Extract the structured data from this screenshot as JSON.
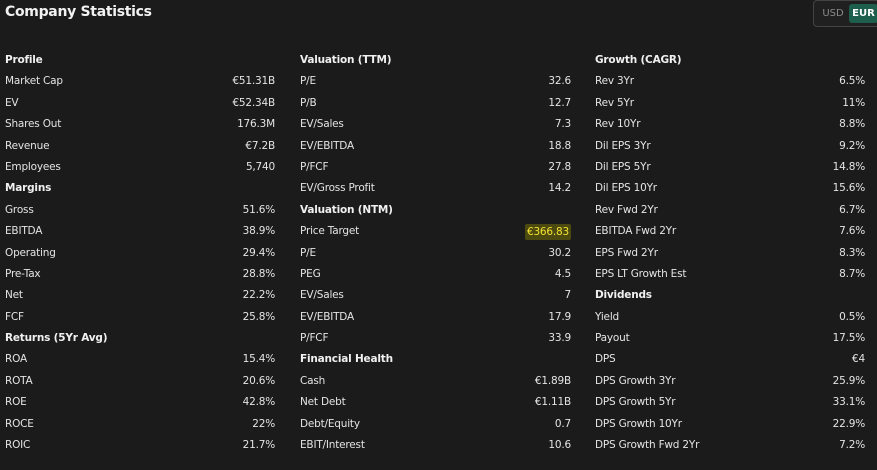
{
  "header": {
    "title": "Company Statistics",
    "currency_usd": "USD",
    "currency_eur": "EUR"
  },
  "columns": [
    {
      "sections": [
        {
          "title": "Profile",
          "rows": [
            {
              "label": "Market Cap",
              "value": "€51.31B"
            },
            {
              "label": "EV",
              "value": "€52.34B"
            },
            {
              "label": "Shares Out",
              "value": "176.3M"
            },
            {
              "label": "Revenue",
              "value": "€7.2B"
            },
            {
              "label": "Employees",
              "value": "5,740"
            }
          ]
        },
        {
          "title": "Margins",
          "rows": [
            {
              "label": "Gross",
              "value": "51.6%"
            },
            {
              "label": "EBITDA",
              "value": "38.9%"
            },
            {
              "label": "Operating",
              "value": "29.4%"
            },
            {
              "label": "Pre-Tax",
              "value": "28.8%"
            },
            {
              "label": "Net",
              "value": "22.2%"
            },
            {
              "label": "FCF",
              "value": "25.8%"
            }
          ]
        },
        {
          "title": "Returns (5Yr Avg)",
          "rows": [
            {
              "label": "ROA",
              "value": "15.4%"
            },
            {
              "label": "ROTA",
              "value": "20.6%"
            },
            {
              "label": "ROE",
              "value": "42.8%"
            },
            {
              "label": "ROCE",
              "value": "22%"
            },
            {
              "label": "ROIC",
              "value": "21.7%"
            }
          ]
        }
      ]
    },
    {
      "sections": [
        {
          "title": "Valuation (TTM)",
          "rows": [
            {
              "label": "P/E",
              "value": "32.6"
            },
            {
              "label": "P/B",
              "value": "12.7"
            },
            {
              "label": "EV/Sales",
              "value": "7.3"
            },
            {
              "label": "EV/EBITDA",
              "value": "18.8"
            },
            {
              "label": "P/FCF",
              "value": "27.8"
            },
            {
              "label": "EV/Gross Profit",
              "value": "14.2"
            }
          ]
        },
        {
          "title": "Valuation (NTM)",
          "rows": [
            {
              "label": "Price Target",
              "value": "€366.83",
              "highlight": true
            },
            {
              "label": "P/E",
              "value": "30.2"
            },
            {
              "label": "PEG",
              "value": "4.5"
            },
            {
              "label": "EV/Sales",
              "value": "7"
            },
            {
              "label": "EV/EBITDA",
              "value": "17.9"
            },
            {
              "label": "P/FCF",
              "value": "33.9"
            }
          ]
        },
        {
          "title": "Financial Health",
          "rows": [
            {
              "label": "Cash",
              "value": "€1.89B"
            },
            {
              "label": "Net Debt",
              "value": "€1.11B"
            },
            {
              "label": "Debt/Equity",
              "value": "0.7"
            },
            {
              "label": "EBIT/Interest",
              "value": "10.6"
            }
          ]
        }
      ]
    },
    {
      "sections": [
        {
          "title": "Growth (CAGR)",
          "rows": [
            {
              "label": "Rev 3Yr",
              "value": "6.5%"
            },
            {
              "label": "Rev 5Yr",
              "value": "11%"
            },
            {
              "label": "Rev 10Yr",
              "value": "8.8%"
            },
            {
              "label": "Dil EPS 3Yr",
              "value": "9.2%"
            },
            {
              "label": "Dil EPS 5Yr",
              "value": "14.8%"
            },
            {
              "label": "Dil EPS 10Yr",
              "value": "15.6%"
            },
            {
              "label": "Rev Fwd 2Yr",
              "value": "6.7%"
            },
            {
              "label": "EBITDA Fwd 2Yr",
              "value": "7.6%"
            },
            {
              "label": "EPS Fwd 2Yr",
              "value": "8.3%"
            },
            {
              "label": "EPS LT Growth Est",
              "value": "8.7%"
            }
          ]
        },
        {
          "title": "Dividends",
          "rows": [
            {
              "label": "Yield",
              "value": "0.5%"
            },
            {
              "label": "Payout",
              "value": "17.5%"
            },
            {
              "label": "DPS",
              "value": "€4"
            },
            {
              "label": "DPS Growth 3Yr",
              "value": "25.9%"
            },
            {
              "label": "DPS Growth 5Yr",
              "value": "33.1%"
            },
            {
              "label": "DPS Growth 10Yr",
              "value": "22.9%"
            },
            {
              "label": "DPS Growth Fwd 2Yr",
              "value": "7.2%"
            }
          ]
        }
      ]
    }
  ]
}
